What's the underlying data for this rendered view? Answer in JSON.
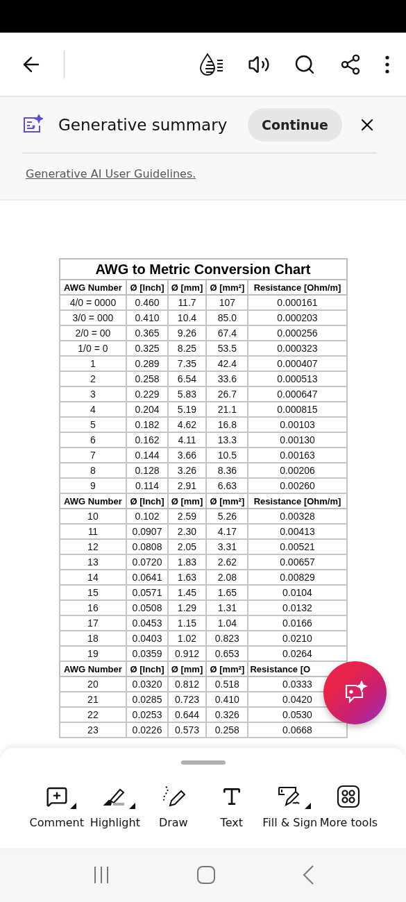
{
  "banner": {
    "title": "Generative summary",
    "button": "Continue",
    "link": "Generative AI User Guidelines."
  },
  "table": {
    "title": "AWG to Metric Conversion Chart",
    "sections": [
      {
        "columns": [
          "AWG Number",
          "Ø [Inch]",
          "Ø [mm]",
          "Ø [mm²]",
          "Resistance [Ohm/m]"
        ],
        "rows": [
          [
            "4/0 = 0000",
            "0.460",
            "11.7",
            "107",
            "0.000161"
          ],
          [
            "3/0 = 000",
            "0.410",
            "10.4",
            "85.0",
            "0.000203"
          ],
          [
            "2/0 = 00",
            "0.365",
            "9.26",
            "67.4",
            "0.000256"
          ],
          [
            "1/0 = 0",
            "0.325",
            "8.25",
            "53.5",
            "0.000323"
          ],
          [
            "1",
            "0.289",
            "7.35",
            "42.4",
            "0.000407"
          ],
          [
            "2",
            "0.258",
            "6.54",
            "33.6",
            "0.000513"
          ],
          [
            "3",
            "0.229",
            "5.83",
            "26.7",
            "0.000647"
          ],
          [
            "4",
            "0.204",
            "5.19",
            "21.1",
            "0.000815"
          ],
          [
            "5",
            "0.182",
            "4.62",
            "16.8",
            "0.00103"
          ],
          [
            "6",
            "0.162",
            "4.11",
            "13.3",
            "0.00130"
          ],
          [
            "7",
            "0.144",
            "3.66",
            "10.5",
            "0.00163"
          ],
          [
            "8",
            "0.128",
            "3.26",
            "8.36",
            "0.00206"
          ],
          [
            "9",
            "0.114",
            "2.91",
            "6.63",
            "0.00260"
          ]
        ]
      },
      {
        "columns": [
          "AWG Number",
          "Ø [Inch]",
          "Ø [mm]",
          "Ø [mm²]",
          "Resistance [Ohm/m]"
        ],
        "rows": [
          [
            "10",
            "0.102",
            "2.59",
            "5.26",
            "0.00328"
          ],
          [
            "11",
            "0.0907",
            "2.30",
            "4.17",
            "0.00413"
          ],
          [
            "12",
            "0.0808",
            "2.05",
            "3.31",
            "0.00521"
          ],
          [
            "13",
            "0.0720",
            "1.83",
            "2.62",
            "0.00657"
          ],
          [
            "14",
            "0.0641",
            "1.63",
            "2.08",
            "0.00829"
          ],
          [
            "15",
            "0.0571",
            "1.45",
            "1.65",
            "0.0104"
          ],
          [
            "16",
            "0.0508",
            "1.29",
            "1.31",
            "0.0132"
          ],
          [
            "17",
            "0.0453",
            "1.15",
            "1.04",
            "0.0166"
          ],
          [
            "18",
            "0.0403",
            "1.02",
            "0.823",
            "0.0210"
          ],
          [
            "19",
            "0.0359",
            "0.912",
            "0.653",
            "0.0264"
          ]
        ]
      },
      {
        "columns": [
          "AWG Number",
          "Ø [Inch]",
          "Ø [mm]",
          "Ø [mm²]",
          "Resistance [O"
        ],
        "rows": [
          [
            "20",
            "0.0320",
            "0.812",
            "0.518",
            "0.0333"
          ],
          [
            "21",
            "0.0285",
            "0.723",
            "0.410",
            "0.0420"
          ],
          [
            "22",
            "0.0253",
            "0.644",
            "0.326",
            "0.0530"
          ],
          [
            "23",
            "0.0226",
            "0.573",
            "0.258",
            "0.0668"
          ]
        ]
      }
    ]
  },
  "tools": [
    {
      "kind": "comment",
      "label": "Comment",
      "has_menu": true
    },
    {
      "kind": "highlight",
      "label": "Highlight",
      "has_menu": true
    },
    {
      "kind": "draw",
      "label": "Draw",
      "has_menu": false
    },
    {
      "kind": "text",
      "label": "Text",
      "has_menu": false
    },
    {
      "kind": "fill-sign",
      "label": "Fill & Sign",
      "has_menu": true
    },
    {
      "kind": "more",
      "label": "More tools",
      "has_menu": false
    }
  ]
}
